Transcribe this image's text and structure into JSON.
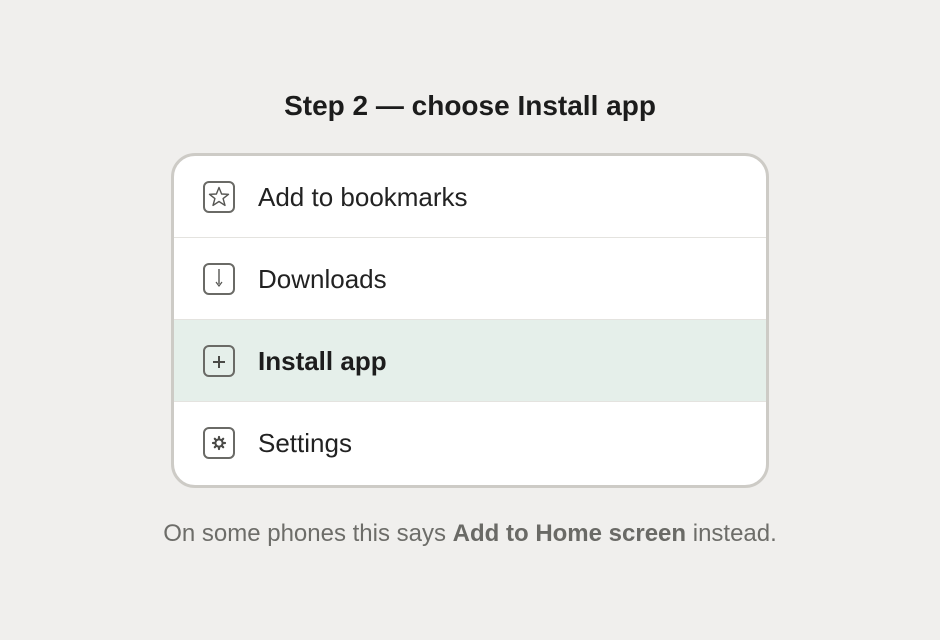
{
  "heading": "Step 2 — choose Install app",
  "menu": {
    "items": [
      {
        "label": "Add to bookmarks",
        "icon": "star-icon",
        "selected": false
      },
      {
        "label": "Downloads",
        "icon": "download-icon",
        "selected": false
      },
      {
        "label": "Install app",
        "icon": "plus-icon",
        "selected": true
      },
      {
        "label": "Settings",
        "icon": "gear-icon",
        "selected": false
      }
    ]
  },
  "hint": {
    "prefix": "On some phones this says ",
    "emphasis": "Add to Home screen",
    "suffix": " instead."
  },
  "colors": {
    "background": "#f0efed",
    "selected_row": "#e5efea",
    "card_border": "#cdcbc6"
  }
}
